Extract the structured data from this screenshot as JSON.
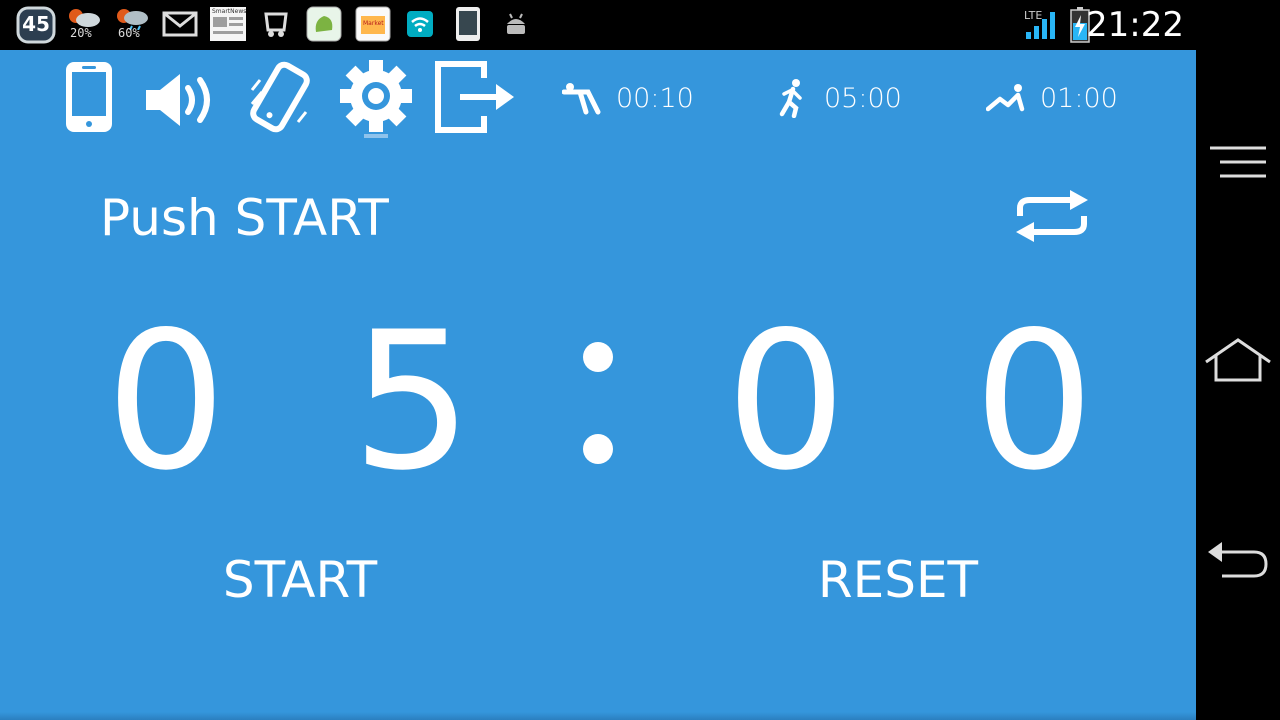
{
  "status_bar": {
    "notification_badge": "45",
    "weather": [
      {
        "icon": "weather-cloudy-sun-icon",
        "percent": "20%"
      },
      {
        "icon": "weather-rain-sun-icon",
        "percent": "60%"
      }
    ],
    "notification_icons": [
      "gmail-icon",
      "smartnews-icon",
      "app-notification-icon",
      "app-notification-icon-2",
      "market-icon",
      "wifi-icon",
      "phone-icon",
      "android-debug-icon"
    ],
    "smartnews_label": "SmartNews",
    "market_label": "Market",
    "network": "LTE",
    "clock": "21:22"
  },
  "toolbar": {
    "tools": [
      "phone-icon",
      "volume-icon",
      "vibrate-icon",
      "settings-gear-icon",
      "exit-icon"
    ],
    "phases": [
      {
        "icon": "stretch-icon",
        "time": "00:10"
      },
      {
        "icon": "running-icon",
        "time": "05:00"
      },
      {
        "icon": "rest-icon",
        "time": "01:00"
      }
    ]
  },
  "main": {
    "status_text": "Push START",
    "timer_digits": [
      "0",
      "5",
      "0",
      "0"
    ],
    "start_label": "START",
    "reset_label": "RESET"
  },
  "colors": {
    "app_background": "#3596dc",
    "status_bar": "#000000",
    "foreground": "#ffffff"
  }
}
